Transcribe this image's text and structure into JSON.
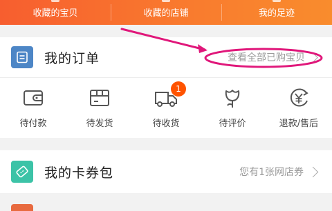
{
  "top_tabs": [
    {
      "label": "收藏的宝贝"
    },
    {
      "label": "收藏的店铺"
    },
    {
      "label": "我的足迹"
    }
  ],
  "orders": {
    "title": "我的订单",
    "link": "查看全部已购宝贝",
    "items": [
      {
        "label": "待付款",
        "icon": "wallet-icon"
      },
      {
        "label": "待发货",
        "icon": "package-icon"
      },
      {
        "label": "待收货",
        "icon": "truck-icon",
        "badge": "1"
      },
      {
        "label": "待评价",
        "icon": "flower-icon"
      },
      {
        "label": "退款/售后",
        "icon": "refund-icon"
      }
    ]
  },
  "coupons": {
    "title": "我的卡券包",
    "summary": "您有1张网店券"
  },
  "colors": {
    "accent": "#f97a2e",
    "orders_icon_bg": "#4d86c6",
    "coupon_icon_bg": "#3cc3a7",
    "badge": "#ff5300",
    "annotation": "#e0177a"
  }
}
